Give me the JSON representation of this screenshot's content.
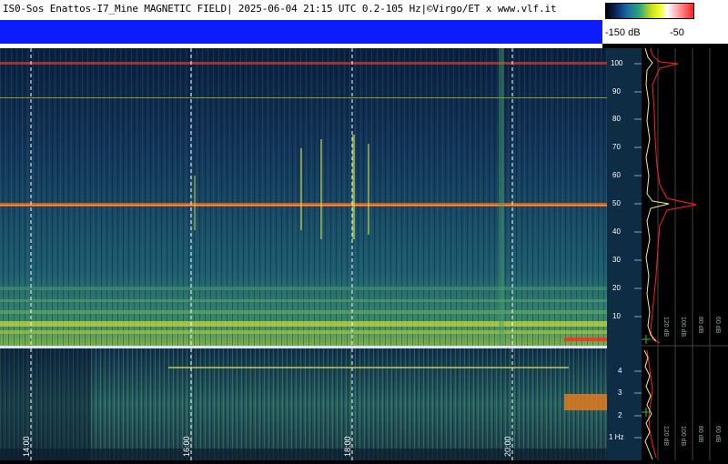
{
  "header": {
    "title": "IS0-Sos Enattos-I7_Mine MAGNETIC FIELD| 2025-06-04 21:15 UTC 0.2-105 Hz|©Virgo/ET x www.vlf.it"
  },
  "legend": {
    "min_label": "-150 dB",
    "max_label": "-50"
  },
  "time_axis": {
    "labels": [
      "14:00",
      "16:00",
      "18:00",
      "20:00"
    ]
  },
  "freq_axis_top": {
    "labels": [
      "100",
      "90",
      "80",
      "70",
      "60",
      "50",
      "40",
      "30",
      "20",
      "10"
    ]
  },
  "freq_axis_bottom": {
    "labels": [
      "4",
      "3",
      "2",
      "1 Hz"
    ]
  },
  "profile_axis": {
    "labels_top": [
      "120 dB",
      "100 dB",
      "80 dB",
      "60 dB",
      "40 dB"
    ],
    "labels_bottom": [
      "120 dB",
      "100 dB",
      "80 dB",
      "60 dB",
      "40 dB"
    ]
  },
  "colors": {
    "spectro_dark": "#0b1e3d",
    "spectro_mid": "#1d5a73",
    "line_orange": "#ff6a1a",
    "line_red": "#ff2020",
    "profile_yellow": "#f2f27a",
    "scale_bg": "#0f2c45"
  }
}
